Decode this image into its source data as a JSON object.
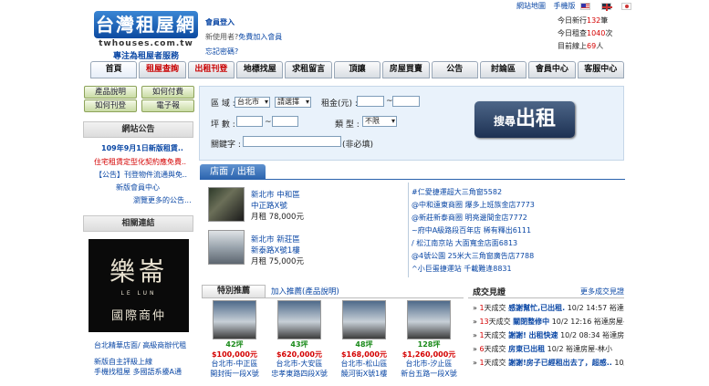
{
  "header": {
    "logo_title": "台灣租屋網",
    "logo_domain": "twhouses.com.tw",
    "logo_slogan": "專注為租屋者服務",
    "member_login": "會員登入",
    "new_user_text": "新使用者?",
    "free_join": "免費加入會員",
    "forgot_password": "忘記密碼?",
    "site_map": "網站地圖",
    "mobile": "手機版",
    "stats": {
      "today_new_pre": "今日新行",
      "today_new": "132",
      "today_new_unit": "筆",
      "today_search_pre": "今日租查",
      "today_search": "1040",
      "today_search_unit": "次",
      "online_pre": "目前線上",
      "online": "69",
      "online_unit": "人"
    }
  },
  "nav": [
    "首頁",
    "租屋查詢",
    "出租刊登",
    "地標找屋",
    "求租留言",
    "頂讓",
    "房屋買賣",
    "公告",
    "討論區",
    "會員中心",
    "客服中心"
  ],
  "side_buttons": [
    "產品說明",
    "如何付費",
    "如何刊登",
    "電子報"
  ],
  "notice": {
    "title": "網站公告",
    "items": [
      "109年9月1日新版租賃..",
      "住宅租賃定型化契約應免費..",
      "【公告】刊登物件流通與免..",
      "新版會員中心",
      "瀏覽更多的公告..."
    ]
  },
  "links": {
    "title": "相關連結",
    "banner_main": "樂崙",
    "banner_sub": "LE  LUN",
    "banner_company": "國際商仲",
    "items": [
      "台北精華店面/ 高級商辦代租",
      "新版自主評級上線",
      "手機找租屋 多國語系擾A通"
    ]
  },
  "search": {
    "area_label": "區 域 :",
    "city": "台北市",
    "district": "請選擇",
    "rent_label": "租金(元) :",
    "tilde": "~",
    "size_label": "坪 數 :",
    "type_label": "類 型 :",
    "type_value": "不限",
    "keyword_label": "關鍵字 :",
    "keyword_note": "(非必填)",
    "go_small": "搜尋",
    "go_big": "出租"
  },
  "shop": {
    "tab": "店面 / 出租",
    "items": [
      {
        "area": "新北市 中和區",
        "addr": "中正路X號",
        "price_label": "月租",
        "price": "78,000元"
      },
      {
        "area": "新北市 新莊區",
        "addr": "新泰路X號1樓",
        "price_label": "月租",
        "price": "75,000元"
      }
    ],
    "right_list": [
      "#仁愛捷運超大三角窗5582",
      "@中和遠東商圈 爆多上班族金店7773",
      "@新莊新泰商圈 明亮邊間金店7772",
      "~府中A級路段百年店 稀有釋出6111",
      "/ 松江南京站 大面寬金店面6813",
      "@4號公園 25米大三角窗廣告店7788",
      "^小巨蛋捷運站 千載難逢8831"
    ]
  },
  "recommend": {
    "tab": "特別推薦",
    "add": "加入推薦(產品說明)",
    "items": [
      {
        "size": "42坪",
        "price": "$100,000元",
        "area": "台北市-中正區",
        "addr": "開封街一段X號"
      },
      {
        "size": "43坪",
        "price": "$620,000元",
        "area": "台北市-大安區",
        "addr": "忠孝東路四段X號"
      },
      {
        "size": "48坪",
        "price": "$168,000元",
        "area": "台北市-松山區",
        "addr": "饒河街X號1樓"
      },
      {
        "size": "128坪",
        "price": "$1,260,000元",
        "area": "台北市-汐止區",
        "addr": "新台五路一段X號"
      }
    ]
  },
  "deals": {
    "title": "成交見證",
    "more": "更多成交見證",
    "items": [
      {
        "days": "1",
        "unit": "天成交",
        "title": "感謝幫忙,已出租.",
        "date": "10/2 14:57",
        "who": "裕達房屋"
      },
      {
        "days": "13",
        "unit": "天成交",
        "title": "關閉整修中",
        "date": "10/2 12:16",
        "who": "裕達房屋-林"
      },
      {
        "days": "1",
        "unit": "天成交",
        "title": "謝謝! 出租快速",
        "date": "10/2 08:34",
        "who": "裕達房屋"
      },
      {
        "days": "6",
        "unit": "天成交",
        "title": "房東已出租",
        "date": "10/2",
        "who": "裕達房屋-林小"
      },
      {
        "days": "1",
        "unit": "天成交",
        "title": "謝謝!房子已經租出去了，超感..",
        "date": "10/1",
        "who": ""
      }
    ]
  }
}
